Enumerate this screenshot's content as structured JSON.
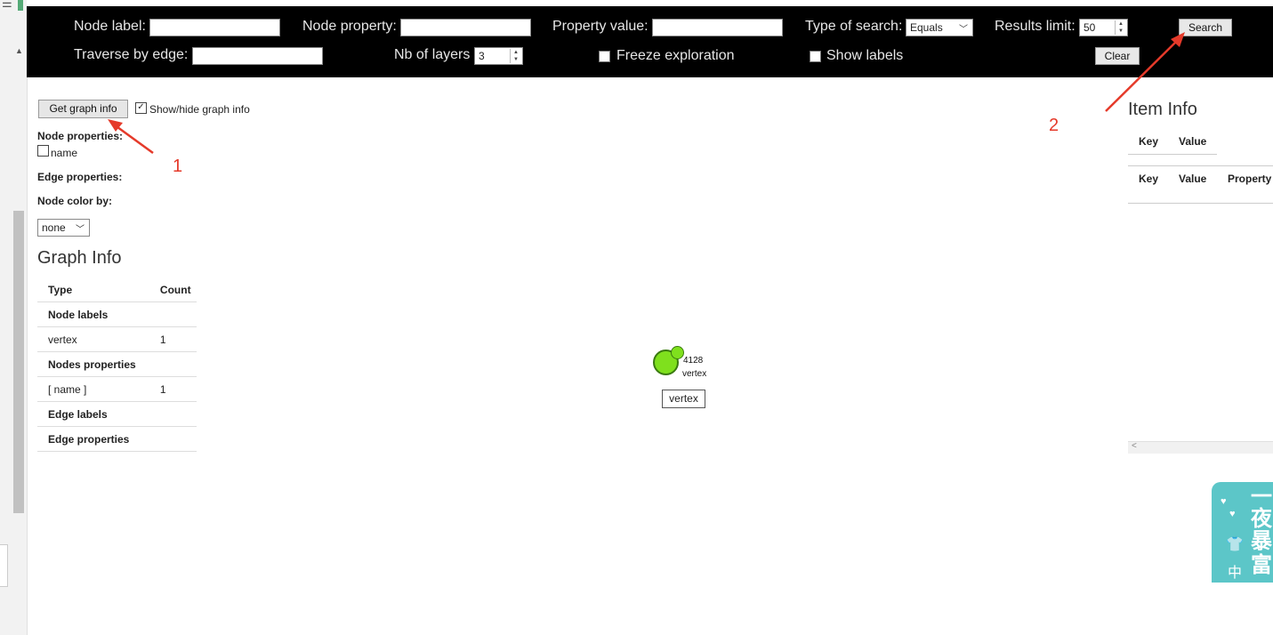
{
  "toolbar": {
    "node_label_label": "Node label:",
    "node_property_label": "Node property:",
    "property_value_label": "Property value:",
    "type_of_search_label": "Type of search:",
    "type_of_search_value": "Equals",
    "results_limit_label": "Results limit:",
    "results_limit_value": "50",
    "search_button": "Search",
    "traverse_by_edge_label": "Traverse by edge:",
    "nb_layers_label": "Nb of layers",
    "nb_layers_value": "3",
    "freeze_label": "Freeze exploration",
    "show_labels_label": "Show labels",
    "clear_button": "Clear"
  },
  "left_panel": {
    "get_graph_info_button": "Get graph info",
    "show_hide_label": "Show/hide graph info",
    "show_hide_checked": true,
    "node_properties_heading": "Node properties:",
    "node_property_option": "name",
    "edge_properties_heading": "Edge properties:",
    "node_color_by_heading": "Node color by:",
    "node_color_value": "none"
  },
  "graph_info": {
    "title": "Graph Info",
    "headers": [
      "Type",
      "Count"
    ],
    "rows": [
      {
        "type": "Node labels",
        "count": "",
        "bold": true
      },
      {
        "type": "vertex",
        "count": "1",
        "bold": false
      },
      {
        "type": "Nodes properties",
        "count": "",
        "bold": true
      },
      {
        "type": "[ name ]",
        "count": "1",
        "bold": false
      },
      {
        "type": "Edge labels",
        "count": "",
        "bold": true
      },
      {
        "type": "Edge properties",
        "count": "",
        "bold": true
      }
    ]
  },
  "graph": {
    "node_id": "4128",
    "node_type": "vertex",
    "node_label": "vertex",
    "node_color": "#7fe01d"
  },
  "item_info": {
    "title": "Item Info",
    "table1_headers": [
      "Key",
      "Value"
    ],
    "table2_headers": [
      "Key",
      "Value",
      "Property"
    ]
  },
  "annotations": {
    "one": "1",
    "two": "2",
    "color": "#e53a2a"
  },
  "ad": {
    "chars": [
      "一",
      "夜",
      "暴",
      "富"
    ],
    "small": "中"
  }
}
